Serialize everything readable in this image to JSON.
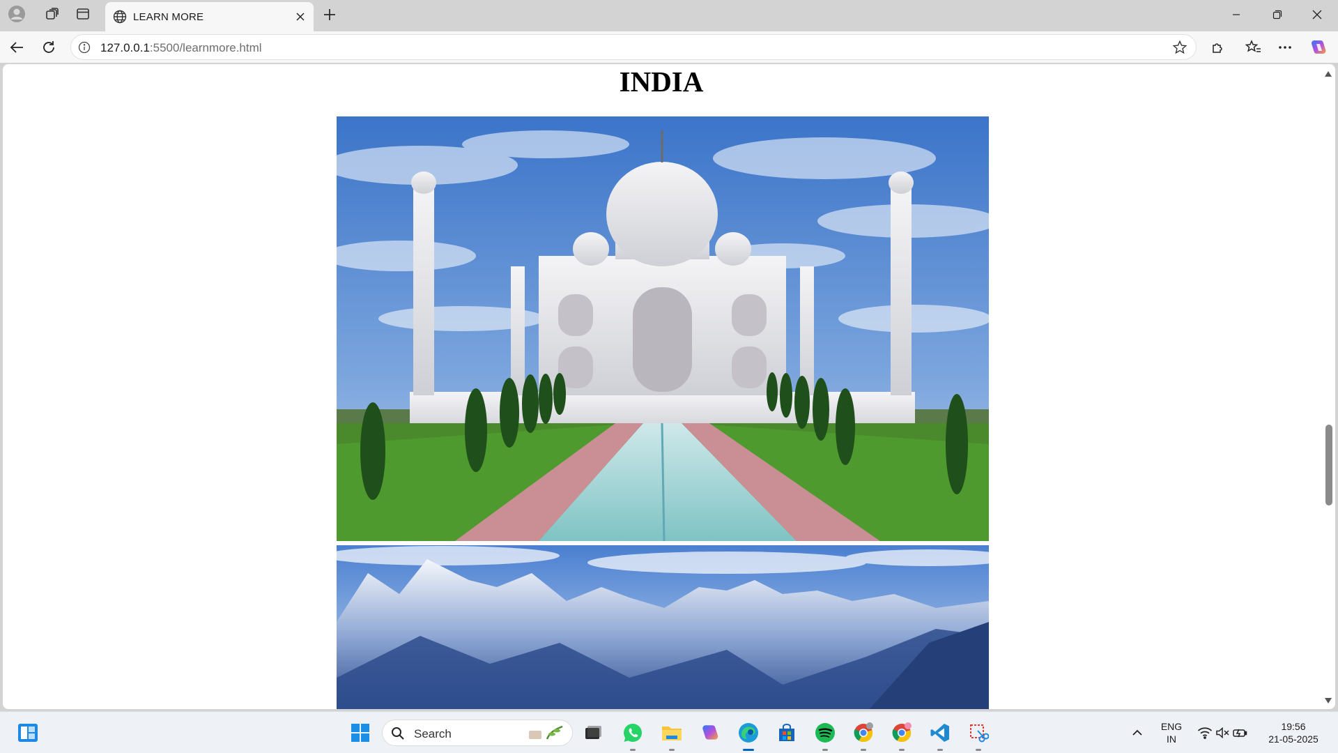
{
  "browser": {
    "tab": {
      "title": "LEARN MORE",
      "icon": "globe-icon"
    },
    "address": {
      "host": "127.0.0.1",
      "path": ":5500/learnmore.html"
    }
  },
  "page": {
    "title": "INDIA",
    "images": [
      {
        "subject": "taj-mahal",
        "alt": "Taj Mahal"
      },
      {
        "subject": "himalayan-mountains",
        "alt": "Himalayan mountains"
      }
    ]
  },
  "taskbar": {
    "search_placeholder": "Search",
    "apps": [
      "windows-start",
      "search",
      "file-explorer-task-view",
      "whatsapp",
      "file-explorer",
      "copilot",
      "edge",
      "microsoft-store",
      "spotify",
      "chrome",
      "chrome-profile",
      "vs-code",
      "snipping-tool"
    ],
    "tray": {
      "language": "ENG",
      "region": "IN",
      "time": "19:56",
      "date": "21-05-2025"
    }
  },
  "colors": {
    "tabstrip": "#d3d3d3",
    "toolbar": "#f7f7f7",
    "page_bg": "#ffffff",
    "taskbar": "#eef1f6",
    "accent": "#0067c0"
  }
}
